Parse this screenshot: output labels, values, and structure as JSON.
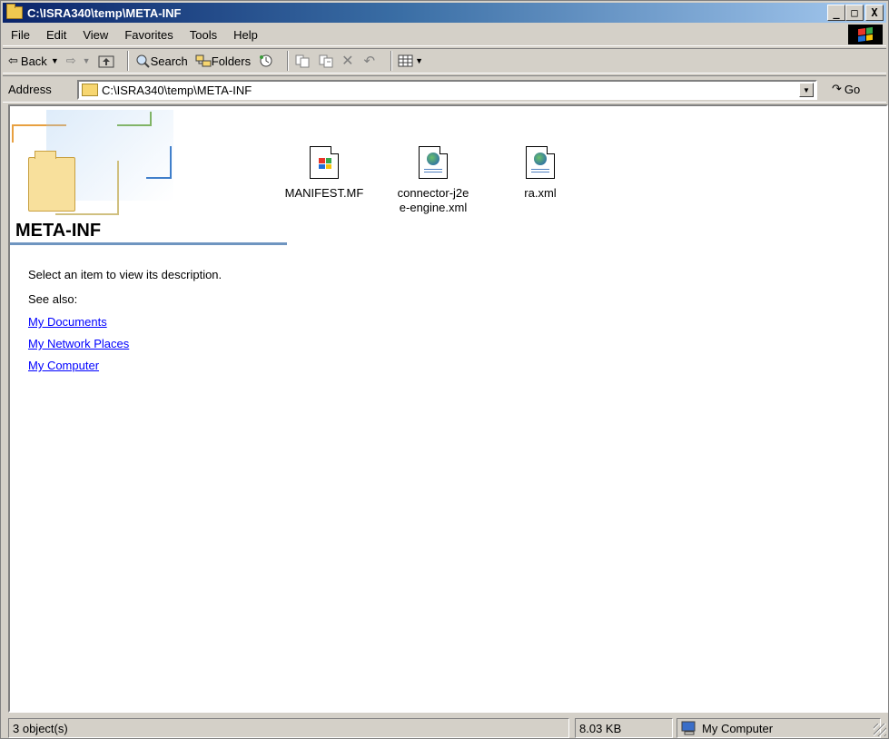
{
  "window": {
    "title": "C:\\ISRA340\\temp\\META-INF",
    "minimize": "_",
    "maximize": "□",
    "close": "X"
  },
  "menu": [
    "File",
    "Edit",
    "View",
    "Favorites",
    "Tools",
    "Help"
  ],
  "toolbar": {
    "back": "Back",
    "search": "Search",
    "folders": "Folders"
  },
  "address": {
    "label": "Address",
    "value": "C:\\ISRA340\\temp\\META-INF",
    "go": "Go"
  },
  "sidebar": {
    "title": "META-INF",
    "description": "Select an item to view its description.",
    "see_also": "See also:",
    "links": [
      "My Documents",
      "My Network Places",
      "My Computer"
    ]
  },
  "files": [
    {
      "name": "MANIFEST.MF",
      "icon": "manifest-file-icon"
    },
    {
      "name": "connector-j2ee-engine.xml",
      "line1": "connector-j2e",
      "line2": "e-engine.xml",
      "icon": "xml-file-icon"
    },
    {
      "name": "ra.xml",
      "icon": "xml-file-icon"
    }
  ],
  "status": {
    "objects": "3 object(s)",
    "size": "8.03 KB",
    "zone": "My Computer"
  },
  "colors": {
    "title_start": "#0a246a",
    "title_end": "#a6caf0",
    "link": "#0000ff",
    "chrome": "#d4d0c8"
  }
}
